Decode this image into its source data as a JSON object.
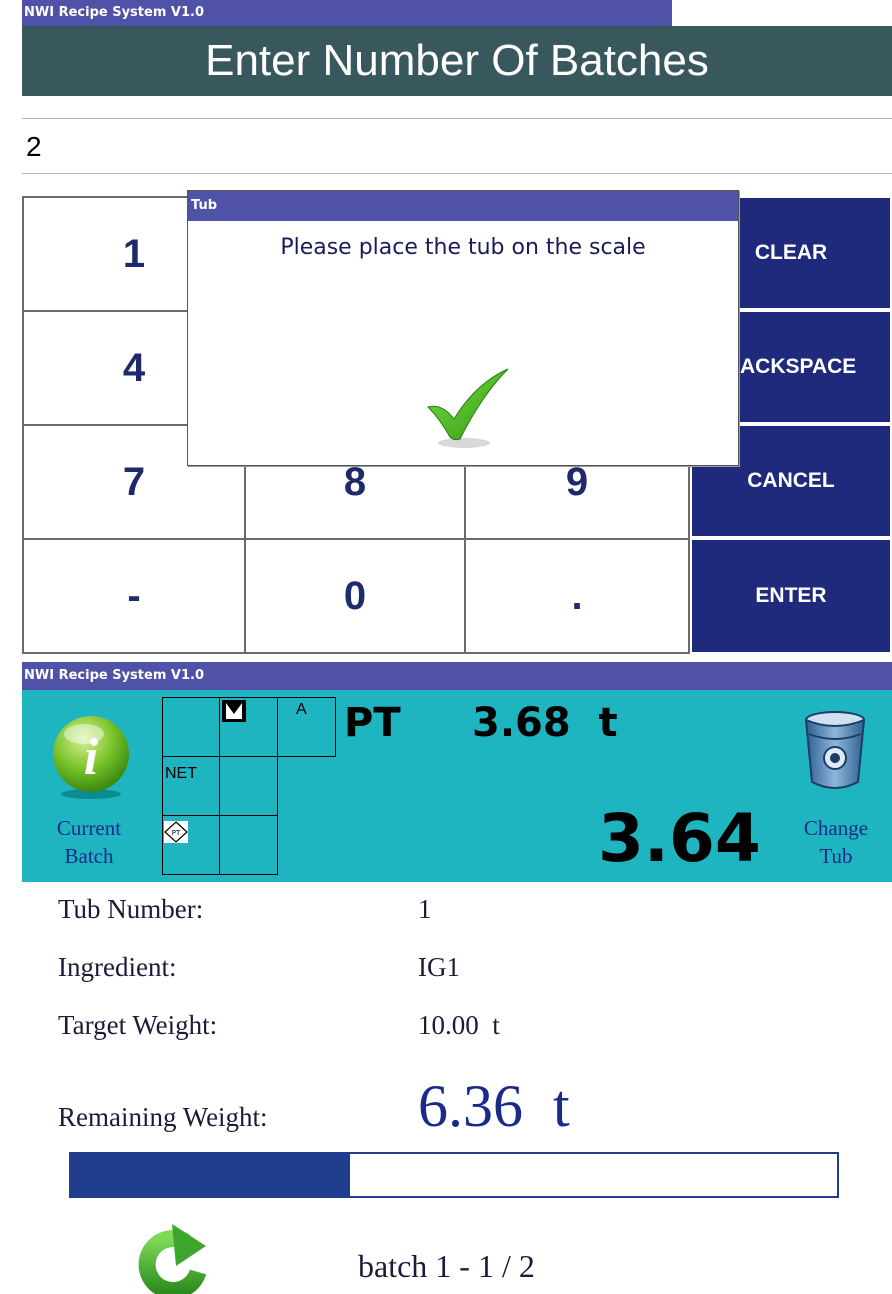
{
  "top_window": {
    "title": "NWI Recipe System V1.0",
    "header": "Enter Number Of Batches",
    "input_value": "2",
    "keypad": [
      "1",
      "4",
      "7",
      "8",
      "9",
      "-",
      "0",
      "."
    ],
    "function_keys": {
      "clear": "CLEAR",
      "backspace": "ACKSPACE",
      "cancel": "CANCEL",
      "enter": "ENTER"
    }
  },
  "dialog": {
    "title": "Tub",
    "message": "Please place the tub on the scale",
    "ok_icon": "checkmark-icon"
  },
  "bottom_window": {
    "title": "NWI Recipe System V1.0",
    "current_batch": "Current Batch",
    "info_icon": "info-icon",
    "indicators": {
      "net": "NET",
      "a": "A",
      "pt": "PT"
    },
    "pt_label": "PT",
    "tare_value": "3.68  t",
    "weight": "3.64",
    "change_tub": "Change Tub",
    "tub_icon": "tub-icon"
  },
  "details": {
    "tub_number_label": "Tub Number:",
    "tub_number": "1",
    "ingredient_label": "Ingredient:",
    "ingredient": "IG1",
    "target_weight_label": "Target Weight:",
    "target_weight": "10.00  t",
    "remaining_weight_label": "Remaining Weight:",
    "remaining_weight": "6.36  t",
    "progress_fraction": 0.364,
    "batch": "batch 1 - 1 / 2",
    "refresh_icon": "refresh-icon"
  },
  "colors": {
    "titlebar": "#4f52a7",
    "header": "#38585d",
    "function_key": "#1f2a7c",
    "scale_panel": "#1fb5c0",
    "progress": "#1f3d8c"
  }
}
